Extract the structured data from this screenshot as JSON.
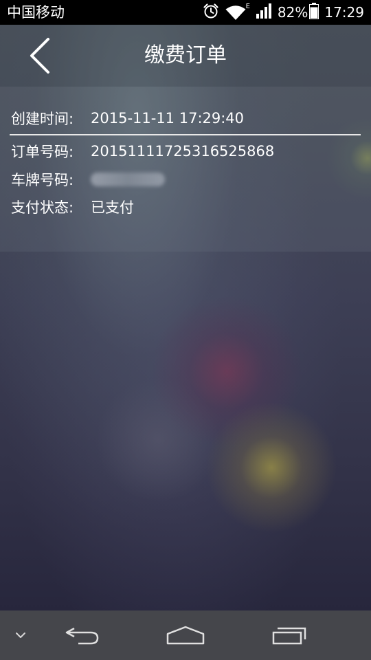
{
  "status_bar": {
    "carrier": "中国移动",
    "network_type": "E",
    "battery_percent": "82%",
    "time": "17:29"
  },
  "header": {
    "title": "缴费订单"
  },
  "order": {
    "created_label": "创建时间:",
    "created_value": "2015-11-11 17:29:40",
    "order_no_label": "订单号码:",
    "order_no_value": "20151111725316525868",
    "plate_label": "车牌号码:",
    "plate_value": "",
    "pay_status_label": "支付状态:",
    "pay_status_value": "已支付"
  },
  "colors": {
    "status_bar_bg": "#000000",
    "nav_bar_bg": "#45464b",
    "text": "#ffffff"
  },
  "icons": {
    "status": [
      "alarm-icon",
      "wifi-icon",
      "signal-icon",
      "battery-icon"
    ],
    "nav": [
      "chevron-down-icon",
      "back-arrow-icon",
      "home-icon",
      "recent-apps-icon"
    ]
  }
}
